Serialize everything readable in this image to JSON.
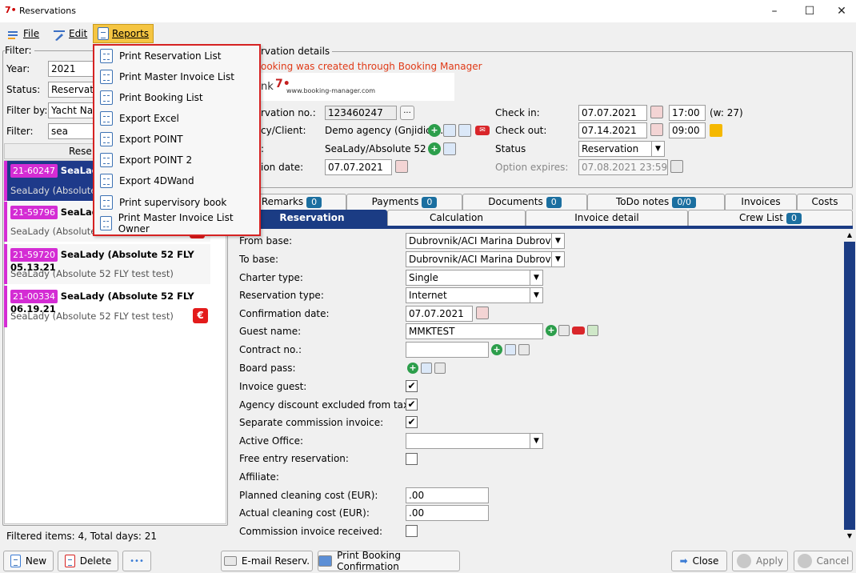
{
  "window": {
    "title": "Reservations",
    "minimize": "–",
    "maximize": "☐",
    "close": "✕"
  },
  "menubar": {
    "file": "File",
    "edit": "Edit",
    "reports": "Reports"
  },
  "reports_menu": [
    "Print Reservation List",
    "Print Master Invoice List",
    "Print Booking List",
    "Export Excel",
    "Export POINT",
    "Export POINT 2",
    "Export 4DWand",
    "Print supervisory book",
    "Print Master Invoice List Owner"
  ],
  "filter": {
    "legend": "Filter:",
    "year_label": "Year:",
    "year_value": "2021",
    "status_label": "Status:",
    "status_value": "Reservatio",
    "filterby_label": "Filter by:",
    "filterby_value": "Yacht Nam",
    "filter_label": "Filter:",
    "filter_value": "sea",
    "list_header": "Rese"
  },
  "reservations": [
    {
      "id": "21-60247",
      "title": "SeaLady",
      "sub": "SeaLady (Absolute 5"
    },
    {
      "id": "21-59796",
      "title": "SeaLady",
      "sub": "SeaLady (Absolute 5"
    },
    {
      "id": "21-59720",
      "title": "SeaLady (Absolute 52 FLY  05.13.21",
      "sub": "SeaLady (Absolute 52 FLY test test)"
    },
    {
      "id": "21-00334",
      "title": "SeaLady (Absolute 52 FLY  06.19.21",
      "sub": "SeaLady (Absolute 52 FLY test test)",
      "euro": "€"
    }
  ],
  "footer_left": "Filtered items: 4,  Total days: 21",
  "details": {
    "legend": "rvation details",
    "notice": "ooking was created through Booking Manager",
    "logo_text": "www.booking-manager.com",
    "logo_mark": "nk",
    "resno_label": "rvation no.:",
    "resno_value": "123460247",
    "resno_btn": "...",
    "agency_label": "cy/Client:",
    "agency_value": "Demo agency (Gnjidic ...",
    "yacht_label": ":",
    "yacht_value": "SeaLady/Absolute 52 ...",
    "optdate_label": "ion date:",
    "optdate_value": "07.07.2021",
    "checkin_label": "Check in:",
    "checkin_value": "07.07.2021",
    "checkin_time": "17:00",
    "week": "(w: 27)",
    "checkout_label": "Check out:",
    "checkout_value": "07.14.2021",
    "checkout_time": "09:00",
    "status_label": "Status",
    "status_value": "Reservation",
    "optexp_label": "Option expires:",
    "optexp_value": "07.08.2021 23:59"
  },
  "tabs_row1": [
    {
      "label": "Remarks",
      "badge": "0"
    },
    {
      "label": "Payments",
      "badge": "0"
    },
    {
      "label": "Documents",
      "badge": "0"
    },
    {
      "label": "ToDo notes",
      "badge": "0/0"
    },
    {
      "label": "Invoices"
    },
    {
      "label": "Costs"
    }
  ],
  "tabs_row2": [
    {
      "label": "Reservation"
    },
    {
      "label": "Calculation"
    },
    {
      "label": "Invoice detail"
    },
    {
      "label": "Crew List",
      "badge": "0"
    }
  ],
  "form": {
    "from_base_label": "From base:",
    "from_base": "Dubrovnik/ACI Marina Dubrovnik",
    "to_base_label": "To base:",
    "to_base": "Dubrovnik/ACI Marina Dubrovnik",
    "charter_type_label": "Charter type:",
    "charter_type": "Single",
    "res_type_label": "Reservation type:",
    "res_type": "Internet",
    "conf_date_label": "Confirmation date:",
    "conf_date": "07.07.2021",
    "guest_label": "Guest name:",
    "guest": "MMKTEST",
    "contract_label": "Contract no.:",
    "board_label": "Board pass:",
    "invoice_guest_label": "Invoice guest:",
    "agency_disc_label": "Agency discount excluded from tax:",
    "sep_comm_label": "Separate commission invoice:",
    "active_office_label": "Active Office:",
    "free_entry_label": "Free entry reservation:",
    "affiliate_label": "Affiliate:",
    "planned_clean_label": "Planned cleaning cost (EUR):",
    "planned_clean": ".00",
    "actual_clean_label": "Actual cleaning cost (EUR):",
    "actual_clean": ".00",
    "comm_recv_label": "Commission invoice received:",
    "check": "✔"
  },
  "buttons": {
    "new": "New",
    "delete": "Delete",
    "more": "•••",
    "email": "E-mail Reserv.",
    "print_conf": "Print Booking Confirmation",
    "close": "Close",
    "apply": "Apply",
    "cancel": "Cancel"
  }
}
